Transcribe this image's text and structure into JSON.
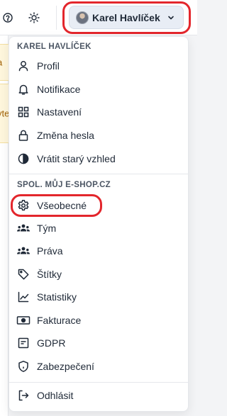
{
  "topbar": {
    "help_icon": "help-circle-icon",
    "theme_icon": "sun-icon",
    "user_name": "Karel Havlíček"
  },
  "background": {
    "snippet_1": "a",
    "snippet_2": "yte"
  },
  "menu": {
    "user_section_title": "KAREL HAVLÍČEK",
    "user_items": [
      {
        "label": "Profil",
        "icon": "user-icon"
      },
      {
        "label": "Notifikace",
        "icon": "bell-icon"
      },
      {
        "label": "Nastavení",
        "icon": "grid-icon"
      },
      {
        "label": "Změna hesla",
        "icon": "lock-icon"
      },
      {
        "label": "Vrátit starý vzhled",
        "icon": "contrast-icon"
      }
    ],
    "company_section_title": "SPOL. MŮJ E-SHOP.CZ",
    "company_items": [
      {
        "label": "Všeobecné",
        "icon": "gear-icon"
      },
      {
        "label": "Tým",
        "icon": "users-icon"
      },
      {
        "label": "Práva",
        "icon": "users-icon"
      },
      {
        "label": "Štítky",
        "icon": "tag-icon"
      },
      {
        "label": "Statistiky",
        "icon": "chart-icon"
      },
      {
        "label": "Fakturace",
        "icon": "money-icon"
      },
      {
        "label": "GDPR",
        "icon": "id-card-icon"
      },
      {
        "label": "Zabezpečení",
        "icon": "shield-icon"
      }
    ],
    "logout_label": "Odhlásit",
    "logout_icon": "logout-icon"
  },
  "colors": {
    "highlight": "#e3262c",
    "user_button_bg": "#e8edf5",
    "warning_bg": "#fef6dc"
  }
}
